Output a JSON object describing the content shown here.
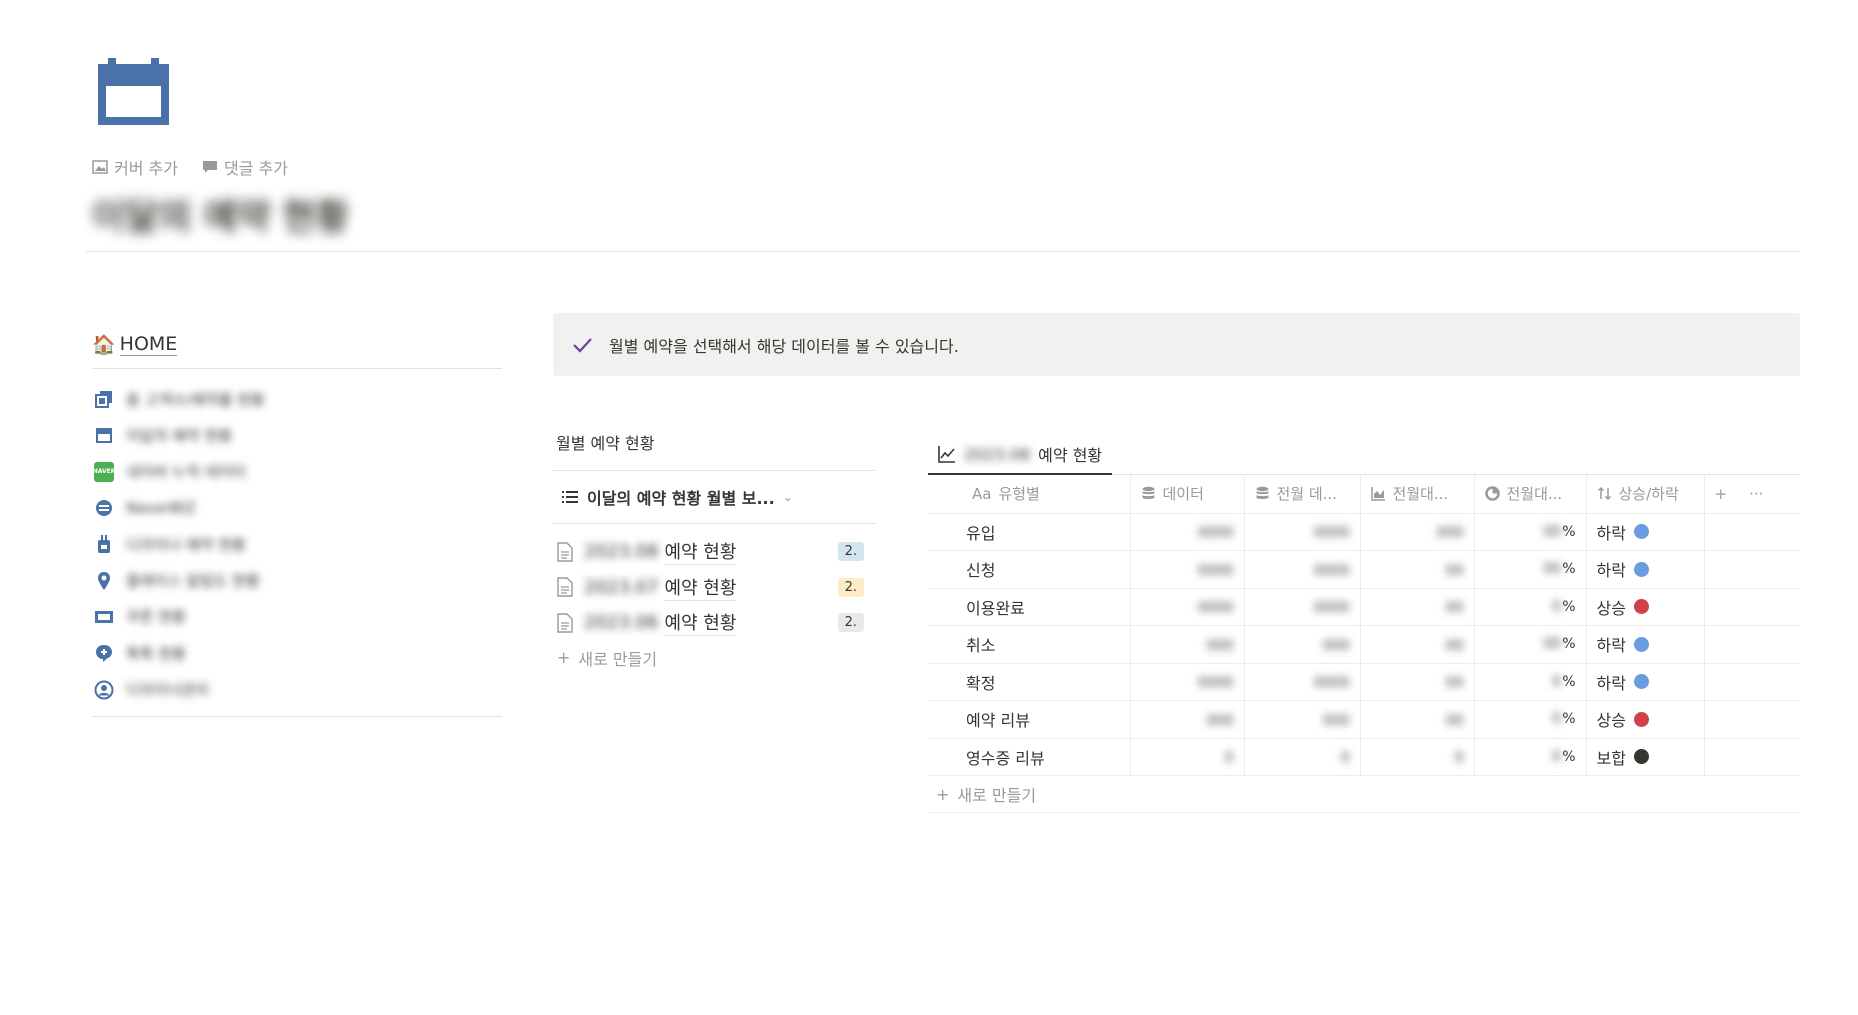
{
  "page": {
    "icon": "calendar-icon",
    "add_cover": "커버 추가",
    "add_comment": "댓글 추가",
    "title": "이달의 예약 현황"
  },
  "nav": {
    "home_label": "HOME",
    "items": [
      {
        "icon": "copy-icon",
        "label": "총 고객수/예약률 현황"
      },
      {
        "icon": "calendar-icon",
        "label": "이달의 예약 현황"
      },
      {
        "icon": "naver-badge",
        "label": "네이버 누적 데이터"
      },
      {
        "icon": "swap-icon",
        "label": "NaverBIZ"
      },
      {
        "icon": "plug-icon",
        "label": "디자이너 예약 현황"
      },
      {
        "icon": "pin-icon",
        "label": "플레이스 알림도 현황"
      },
      {
        "icon": "ticket-icon",
        "label": "쿠폰 현황"
      },
      {
        "icon": "chat-plus-icon",
        "label": "톡톡 현황"
      },
      {
        "icon": "user-circle-icon",
        "label": "디자이너관리"
      }
    ]
  },
  "callout": {
    "icon": "check-icon",
    "text": "월별 예약을 선택해서 해당 데이터를 볼 수 있습니다."
  },
  "monthly": {
    "title": "월별 예약 현황",
    "view_tab": "이달의 예약 현황 월별 보...",
    "docs": [
      {
        "prefix": "2023.08",
        "name": "예약 현황",
        "badge": "2.",
        "badge_color": "#d3e5ef"
      },
      {
        "prefix": "2023.07",
        "name": "예약 현황",
        "badge": "2.",
        "badge_color": "#fdecc8"
      },
      {
        "prefix": "2023.06",
        "name": "예약 현황",
        "badge": "2.",
        "badge_color": "#e9e9e7"
      }
    ],
    "new_label": "새로 만들기"
  },
  "table": {
    "tab_prefix": "2023.08",
    "tab_label": "예약 현황",
    "columns": [
      "유형별",
      "데이터",
      "전월 데...",
      "전월대...",
      "전월대...",
      "상승/하락"
    ],
    "column_icons": [
      "title-icon",
      "database-icon",
      "database-icon",
      "chart-icon",
      "pie-icon",
      "sort-icon"
    ],
    "title_prefix": "Aa",
    "rows": [
      {
        "name": "유입",
        "data": "0000",
        "prev": "0000",
        "diff": "000",
        "pct": "00",
        "status": "하락",
        "color": "#6b9be0"
      },
      {
        "name": "신청",
        "data": "0000",
        "prev": "0000",
        "diff": "00",
        "pct": "00",
        "status": "하락",
        "color": "#6b9be0"
      },
      {
        "name": "이용완료",
        "data": "0000",
        "prev": "0000",
        "diff": "00",
        "pct": "0",
        "status": "상승",
        "color": "#d1404b"
      },
      {
        "name": "취소",
        "data": "000",
        "prev": "000",
        "diff": "00",
        "pct": "00",
        "status": "하락",
        "color": "#6b9be0"
      },
      {
        "name": "확정",
        "data": "0000",
        "prev": "0000",
        "diff": "00",
        "pct": "0",
        "status": "하락",
        "color": "#6b9be0"
      },
      {
        "name": "예약 리뷰",
        "data": "000",
        "prev": "000",
        "diff": "00",
        "pct": "0",
        "status": "상승",
        "color": "#d1404b"
      },
      {
        "name": "영수증 리뷰",
        "data": "0",
        "prev": "0",
        "diff": "0",
        "pct": "0",
        "status": "보합",
        "color": "#37352f"
      }
    ],
    "pct_suffix": "%",
    "new_label": "새로 만들기"
  }
}
